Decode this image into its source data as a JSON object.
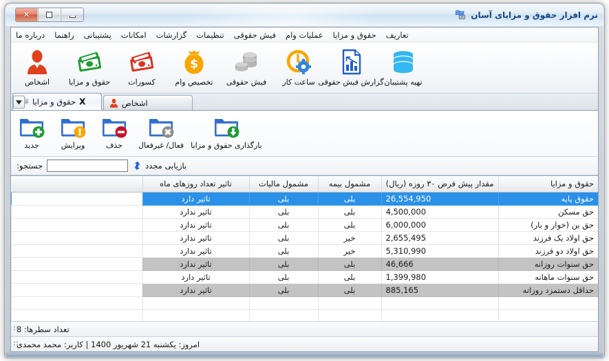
{
  "window": {
    "title": "نرم افزار حقوق و مزایای آسان",
    "logo_icon": "app-logo-icon",
    "controls": {
      "close": "close-icon",
      "maximize": "maximize-icon",
      "minimize": "minimize-icon"
    }
  },
  "menubar": {
    "items": [
      {
        "label": "تعاریف",
        "name": "menu-taarif"
      },
      {
        "label": "حقوق و مزایا",
        "name": "menu-hoghoogh-mazaya"
      },
      {
        "label": "عملیات وام",
        "name": "menu-amaliat-vam"
      },
      {
        "label": "فیش حقوقی",
        "name": "menu-fish-hoghooghi"
      },
      {
        "label": "تنظیمات",
        "name": "menu-tanzimat"
      },
      {
        "label": "گزارشات",
        "name": "menu-gozareshat"
      },
      {
        "label": "امکانات",
        "name": "menu-emkanat"
      },
      {
        "label": "پشتیبانی",
        "name": "menu-poshtibani"
      },
      {
        "label": "راهنما",
        "name": "menu-rahnama"
      },
      {
        "label": "درباره ما",
        "name": "menu-darbareye-ma"
      }
    ]
  },
  "toolbar": {
    "items": [
      {
        "label": "اشخاص",
        "icon": "person-icon",
        "color": "#e0401c"
      },
      {
        "label": "حقوق و مزایا",
        "icon": "money-green-icon",
        "color": "#1f9c34"
      },
      {
        "label": "کسورات",
        "icon": "money-red-icon",
        "color": "#e0301c"
      },
      {
        "label": "تخصیص وام",
        "icon": "money-bag-icon",
        "color": "#f9a602"
      },
      {
        "label": "فیش حقوقی",
        "icon": "coins-icon",
        "color": "#8d8d8d"
      },
      {
        "label": "ساعت کار",
        "icon": "clock-gear-icon",
        "color": "#f9a602"
      },
      {
        "label": "گزارش فیش حقوقی",
        "icon": "report-chart-icon",
        "color": "#1e5fd0"
      },
      {
        "label": "تهیه پشتیبان",
        "icon": "database-icon",
        "color": "#35b6ef"
      }
    ]
  },
  "tabs": [
    {
      "label": "اشخاص",
      "icon": "person-small-icon",
      "active": false,
      "closable": false
    },
    {
      "label": "حقوق و مزایا",
      "icon": "coins-small-icon",
      "active": true,
      "closable": true,
      "close_glyph": "X"
    }
  ],
  "tab_dropdown_icon": "chevron-down-icon",
  "actions": {
    "items": [
      {
        "label": "جدید",
        "icon": "folder-add-icon",
        "badge": "plus",
        "badge_color": "#1f9c34"
      },
      {
        "label": "ویرایش",
        "icon": "folder-edit-icon",
        "badge": "exclaim",
        "badge_color": "#f9a602"
      },
      {
        "label": "حذف",
        "icon": "folder-delete-icon",
        "badge": "minus",
        "badge_color": "#c8102e"
      },
      {
        "label": "فعال/ غیرفعال",
        "icon": "folder-toggle-icon",
        "badge": "cross",
        "badge_color": "#8d8d8d"
      },
      {
        "label": "بارگذاری حقوق و مزایا",
        "icon": "folder-download-icon",
        "badge": "down",
        "badge_color": "#1f9c34"
      }
    ]
  },
  "search": {
    "label": "جستجو:",
    "value": "",
    "placeholder": "",
    "refresh_label": "بازیابی مجدد",
    "refresh_icon": "refresh-icon"
  },
  "grid": {
    "columns": [
      {
        "key": "name",
        "label": "حقوق و مزایا",
        "align": "right"
      },
      {
        "key": "amount",
        "label": "مقدار پیش فرض ۳۰ روزه (ریال)",
        "align": "center"
      },
      {
        "key": "insured",
        "label": "مشمول بیمه",
        "align": "center"
      },
      {
        "key": "taxed",
        "label": "مشمول مالیات",
        "align": "center"
      },
      {
        "key": "dayimpact",
        "label": "تاثیر تعداد روزهای ماه",
        "align": "center"
      },
      {
        "key": "filler",
        "label": "",
        "align": "right"
      }
    ],
    "rows": [
      {
        "name": "حقوق پایه",
        "amount": "26,554,950",
        "insured": "بلی",
        "taxed": "بلی",
        "dayimpact": "تاثیر دارد",
        "state": "selected"
      },
      {
        "name": "حق مسکن",
        "amount": "4,500,000",
        "insured": "بلی",
        "taxed": "بلی",
        "dayimpact": "تاثیر ندارد",
        "state": "normal"
      },
      {
        "name": "حق بن (خوار و بار)",
        "amount": "6,000,000",
        "insured": "بلی",
        "taxed": "بلی",
        "dayimpact": "تاثیر ندارد",
        "state": "normal"
      },
      {
        "name": "حق اولاد یک فرزند",
        "amount": "2,655,495",
        "insured": "خیر",
        "taxed": "بلی",
        "dayimpact": "تاثیر ندارد",
        "state": "normal"
      },
      {
        "name": "حق اولاد دو فرزند",
        "amount": "5,310,990",
        "insured": "خیر",
        "taxed": "بلی",
        "dayimpact": "تاثیر ندارد",
        "state": "normal"
      },
      {
        "name": "حق سنوات روزانه",
        "amount": "46,666",
        "insured": "بلی",
        "taxed": "بلی",
        "dayimpact": "تاثیر ندارد",
        "state": "disabled"
      },
      {
        "name": "حق سنوات ماهانه",
        "amount": "1,399,980",
        "insured": "بلی",
        "taxed": "بلی",
        "dayimpact": "تاثیر دارد",
        "state": "normal"
      },
      {
        "name": "حداقل دستمزد روزانه",
        "amount": "885,165",
        "insured": "بلی",
        "taxed": "بلی",
        "dayimpact": "تاثیر ندارد",
        "state": "disabled"
      },
      {
        "name": "",
        "amount": "",
        "insured": "",
        "taxed": "",
        "dayimpact": "",
        "state": "empty"
      },
      {
        "name": "",
        "amount": "",
        "insured": "",
        "taxed": "",
        "dayimpact": "",
        "state": "empty"
      }
    ]
  },
  "status": {
    "rowcount": "تعداد سطرها:  8",
    "info": "امروز: یکشنبه 21 شهریور 1400   |   کاربر: محمد محمدی"
  },
  "colors": {
    "accent": "#2a90e8",
    "title_text": "#16467f",
    "disabled_row": "#c3c3c3"
  }
}
